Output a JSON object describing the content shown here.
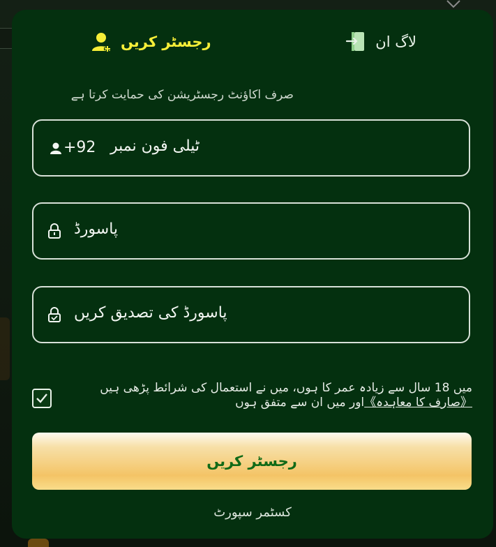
{
  "tabs": {
    "login": {
      "label": "لاگ ان",
      "icon": "door-enter-icon"
    },
    "register": {
      "label": "رجسٹر کریں",
      "icon": "add-user-icon"
    }
  },
  "form": {
    "hint": "صرف اکاؤنٹ رجسٹریشن کی حمایت کرتا ہے",
    "phone": {
      "prefix": "+92",
      "placeholder": "ٹیلی فون نمبر",
      "icon": "user-icon"
    },
    "password": {
      "placeholder": "پاسورڈ",
      "icon": "lock-icon"
    },
    "confirm_password": {
      "placeholder": "پاسورڈ کی تصدیق کریں",
      "icon": "lock-check-icon"
    },
    "agreement": {
      "checked": true,
      "text_before": "میں 18 سال سے زیادہ عمر کا ہوں، میں نے استعمال کی شرائط پڑھی ہیں",
      "link": "《صارف کا معاہدہ》",
      "text_after": "اور میں ان سے متفق ہوں"
    },
    "submit_label": "رجسٹر کریں",
    "support_label": "کسٹمر سپورٹ"
  },
  "colors": {
    "modal_bg": "#04300f",
    "accent_yellow": "#f6ee38",
    "button_gold": "#f4c466",
    "button_text": "#116a17"
  }
}
